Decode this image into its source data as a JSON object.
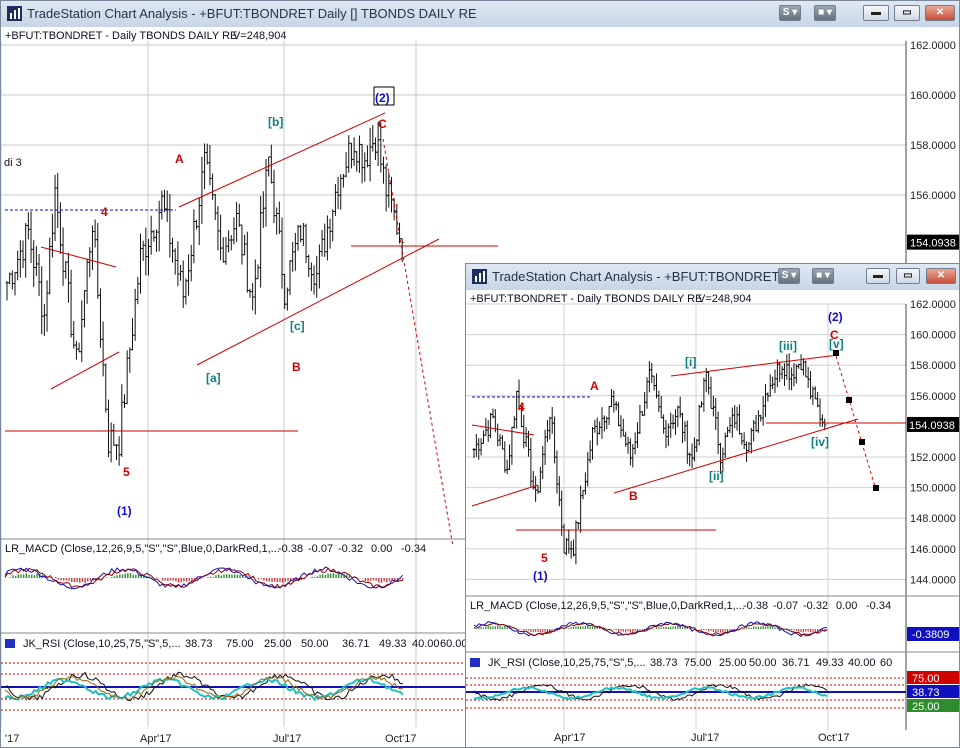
{
  "colors": {
    "wave_red": "#d00000",
    "wave_blue": "#1010c0",
    "wave_teal": "#108080",
    "trend": "#d00000",
    "macd_fast": "#1010c0",
    "macd_slow": "#8b0000",
    "hist": "#2e8b2e"
  },
  "window1": {
    "title": "TradeStation Chart Analysis - +BFUT:TBONDRET Daily [] TBONDS DAILY RE",
    "symbol_line": "+BFUT:TBONDRET - Daily  TBONDS DAILY RE",
    "volume": "V=248,904",
    "side_label": "di 3",
    "price_ticks": [
      "162.0000",
      "160.0000",
      "158.0000",
      "156.0000",
      "154.0938"
    ],
    "current_price": "154.0938",
    "waves": {
      "w4": "4",
      "w5": "5",
      "w1": "(1)",
      "A": "A",
      "B": "B",
      "C": "C",
      "a": "[a]",
      "b": "[b]",
      "c": "[c]",
      "w2": "(2)"
    },
    "macd_label": "LR_MACD (Close,12,26,9,5,\"S\",\"S\",Blue,0,DarkRed,1,...",
    "macd_values": [
      "-0.38",
      "-0.07",
      "-0.32",
      "0.00",
      "-0.34"
    ],
    "rsi_label": "JK_RSI (Close,10,25,75,\"S\",5,...",
    "rsi_values": [
      "38.73",
      "75.00",
      "25.00",
      "50.00",
      "36.71",
      "49.33",
      "40.00",
      "60.00"
    ],
    "x_ticks": [
      "'17",
      "Apr'17",
      "Jul'17",
      "Oct'17"
    ]
  },
  "window2": {
    "title": "TradeStation Chart Analysis - +BFUT:TBONDRET...",
    "symbol_line": "+BFUT:TBONDRET - Daily  TBONDS DAILY RE",
    "volume": "V=248,904",
    "price_ticks": [
      "162.0000",
      "160.0000",
      "158.0000",
      "156.0000",
      "154.0938",
      "152.0000",
      "150.0000",
      "148.0000",
      "146.0000",
      "144.0000"
    ],
    "current_price": "154.0938",
    "waves": {
      "w4": "4",
      "w5": "5",
      "w1": "(1)",
      "A": "A",
      "B": "B",
      "C": "C",
      "i": "[i]",
      "ii": "[ii]",
      "iii": "[iii]",
      "iv": "[iv]",
      "v": "[v]",
      "w2": "(2)"
    },
    "macd_label": "LR_MACD (Close,12,26,9,5,\"S\",\"S\",Blue,0,DarkRed,1,...",
    "macd_values": [
      "-0.38",
      "-0.07",
      "-0.32",
      "0.00",
      "-0.34"
    ],
    "macd_last": "-0.3809",
    "rsi_label": "JK_RSI (Close,10,25,75,\"S\",5,...",
    "rsi_values": [
      "38.73",
      "75.00",
      "25.00",
      "50.00",
      "36.71",
      "49.33",
      "40.00",
      "60"
    ],
    "rsi_axis": [
      "75.00",
      "38.73",
      "25.00"
    ],
    "x_ticks": [
      "Apr'17",
      "Jul'17",
      "Oct'17"
    ]
  }
}
